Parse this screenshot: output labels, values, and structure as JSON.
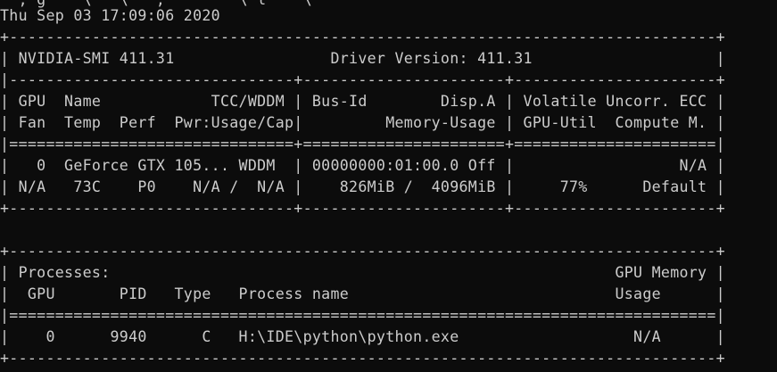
{
  "window": {
    "partial_top_line": "  , g    \\   \\   ,        \\ l    \\  "
  },
  "terminal": {
    "lines": [
      "Thu Sep 03 17:09:06 2020",
      "+-----------------------------------------------------------------------------+",
      "| NVIDIA-SMI 411.31                 Driver Version: 411.31                    |",
      "|-------------------------------+----------------------+----------------------+",
      "| GPU  Name            TCC/WDDM | Bus-Id        Disp.A | Volatile Uncorr. ECC |",
      "| Fan  Temp  Perf  Pwr:Usage/Cap|         Memory-Usage | GPU-Util  Compute M. |",
      "|===============================+======================+======================|",
      "|   0  GeForce GTX 105... WDDM  | 00000000:01:00.0 Off |                  N/A |",
      "| N/A   73C    P0    N/A /  N/A |    826MiB /  4096MiB |     77%      Default |",
      "+-------------------------------+----------------------+----------------------+",
      "",
      "+-----------------------------------------------------------------------------+",
      "| Processes:                                                       GPU Memory |",
      "|  GPU       PID   Type   Process name                             Usage      |",
      "|=============================================================================|",
      "|    0      9940      C   H:\\IDE\\python\\python.exe                   N/A      |",
      "+-----------------------------------------------------------------------------+"
    ]
  }
}
